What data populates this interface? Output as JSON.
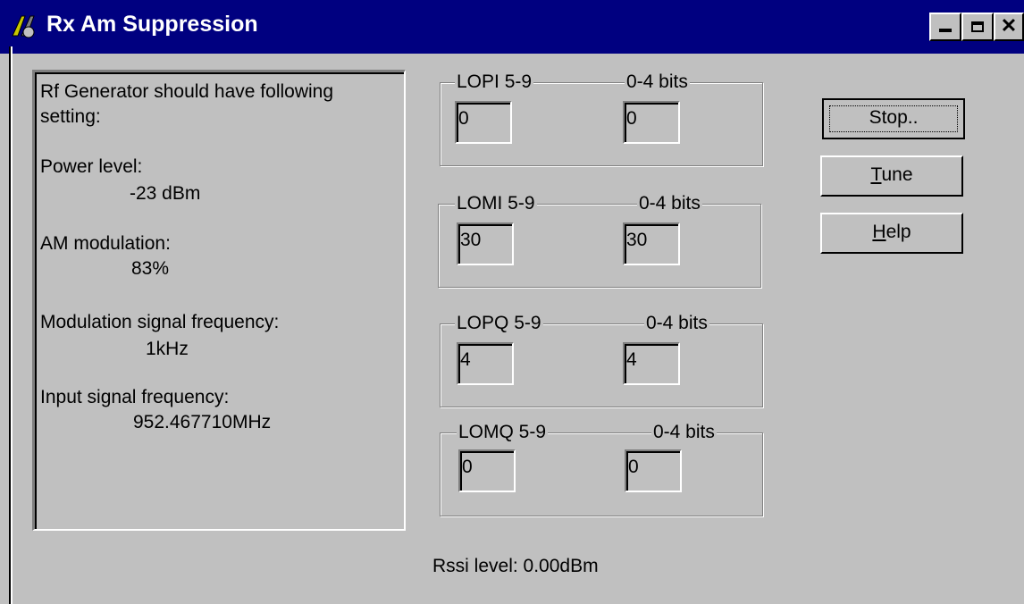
{
  "window": {
    "title": "Rx Am Suppression"
  },
  "info": {
    "line1": "Rf Generator should have following",
    "line2": "setting:",
    "power_label": "Power level:",
    "power_value": "-23 dBm",
    "am_label": "AM modulation:",
    "am_value": "83%",
    "mod_label": "Modulation signal frequency:",
    "mod_value": "1kHz",
    "input_label": "Input signal frequency:",
    "input_value": "952.467710MHz"
  },
  "groups": [
    {
      "label": "LOPI 5-9",
      "bits_label": "0-4 bits",
      "value_hi": "0",
      "value_lo": "0"
    },
    {
      "label": "LOMI 5-9",
      "bits_label": "0-4 bits",
      "value_hi": "30",
      "value_lo": "30"
    },
    {
      "label": "LOPQ 5-9",
      "bits_label": "0-4 bits",
      "value_hi": "4",
      "value_lo": "4"
    },
    {
      "label": "LOMQ 5-9",
      "bits_label": "0-4 bits",
      "value_hi": "0",
      "value_lo": "0"
    }
  ],
  "buttons": {
    "stop": "Stop..",
    "tune_u": "T",
    "tune_rest": "une",
    "help_u": "H",
    "help_rest": "elp"
  },
  "status": {
    "rssi": "Rssi level: 0.00dBm"
  }
}
